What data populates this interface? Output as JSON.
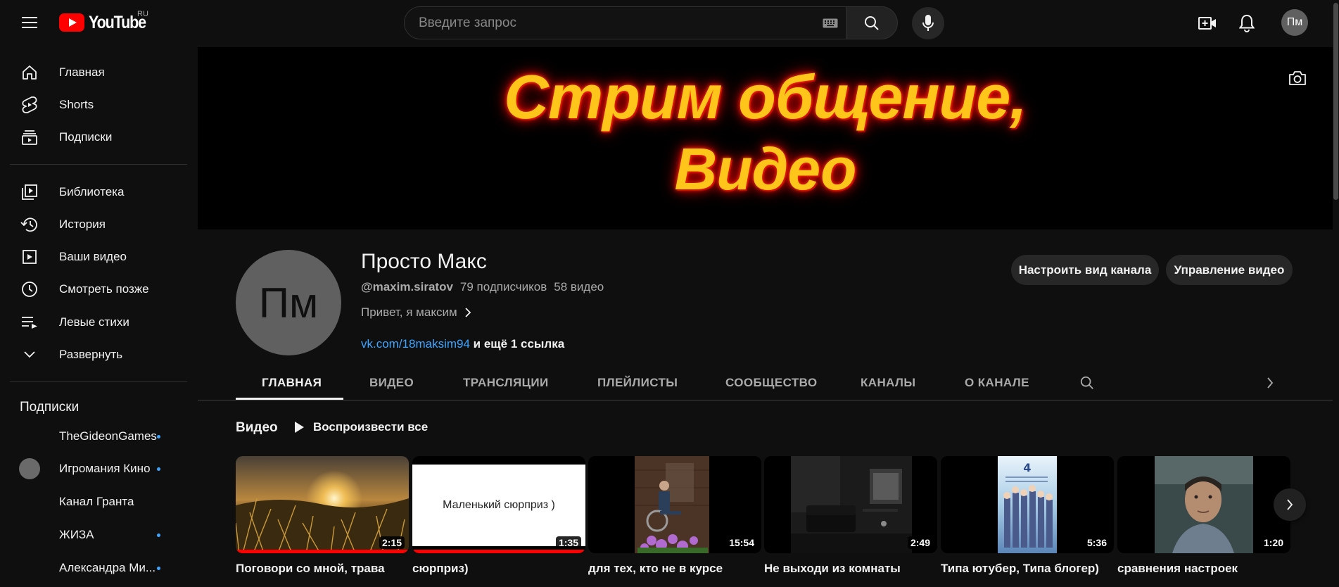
{
  "header": {
    "logo_text": "YouTube",
    "region": "RU",
    "search_placeholder": "Введите запрос",
    "avatar_initials": "Пм"
  },
  "sidebar": {
    "items": [
      {
        "label": "Главная",
        "icon": "home-icon"
      },
      {
        "label": "Shorts",
        "icon": "shorts-icon"
      },
      {
        "label": "Подписки",
        "icon": "subscriptions-icon"
      },
      {
        "label": "Библиотека",
        "icon": "library-icon"
      },
      {
        "label": "История",
        "icon": "history-icon"
      },
      {
        "label": "Ваши видео",
        "icon": "your-videos-icon"
      },
      {
        "label": "Смотреть позже",
        "icon": "watch-later-icon"
      },
      {
        "label": "Левые стихи",
        "icon": "playlist-icon"
      },
      {
        "label": "Развернуть",
        "icon": "chevron-down-icon"
      }
    ],
    "subscriptions_heading": "Подписки",
    "subscriptions": [
      {
        "label": "TheGideonGames",
        "new": true
      },
      {
        "label": "Игромания Кино",
        "new": true
      },
      {
        "label": "Канал Гранта",
        "new": false
      },
      {
        "label": "ЖИЗА",
        "new": true
      },
      {
        "label": "Александра Ми...",
        "new": true
      }
    ]
  },
  "banner": {
    "line1": "Стрим общение,",
    "line2": "Видео"
  },
  "channel": {
    "avatar_initials": "Пм",
    "name": "Просто Макс",
    "handle": "@maxim.siratov",
    "subscribers": "79 подписчиков",
    "videos_count": "58 видео",
    "description": "Привет, я максим",
    "link_url": "vk.com/18maksim94",
    "link_more": "и ещё 1 ссылка",
    "customize_label": "Настроить вид канала",
    "manage_label": "Управление видео"
  },
  "tabs": [
    "ГЛАВНАЯ",
    "ВИДЕО",
    "ТРАНСЛЯЦИИ",
    "ПЛЕЙЛИСТЫ",
    "СООБЩЕСТВО",
    "КАНАЛЫ",
    "О КАНАЛЕ"
  ],
  "videos_section": {
    "title": "Видео",
    "play_all": "Воспроизвести все",
    "videos": [
      {
        "title": "Поговори со мной, трава",
        "duration": "2:15",
        "watched": 1.0
      },
      {
        "title": "сюрприз)",
        "duration": "1:35",
        "watched": 1.0,
        "thumb_text": "Маленький сюрприз )"
      },
      {
        "title": "для тех, кто не в курсе",
        "duration": "15:54",
        "watched": 0
      },
      {
        "title": "Не выходи из комнаты",
        "duration": "2:49",
        "watched": 0
      },
      {
        "title": "Типа ютубер, Типа блогер)",
        "duration": "5:36",
        "watched": 0
      },
      {
        "title": "сравнения настроек",
        "duration": "1:20",
        "watched": 0
      }
    ]
  },
  "colors": {
    "background": "#0f0f0f",
    "accent_red": "#ff0000",
    "link_blue": "#3ea6ff",
    "banner_text": "#ffc51a"
  }
}
